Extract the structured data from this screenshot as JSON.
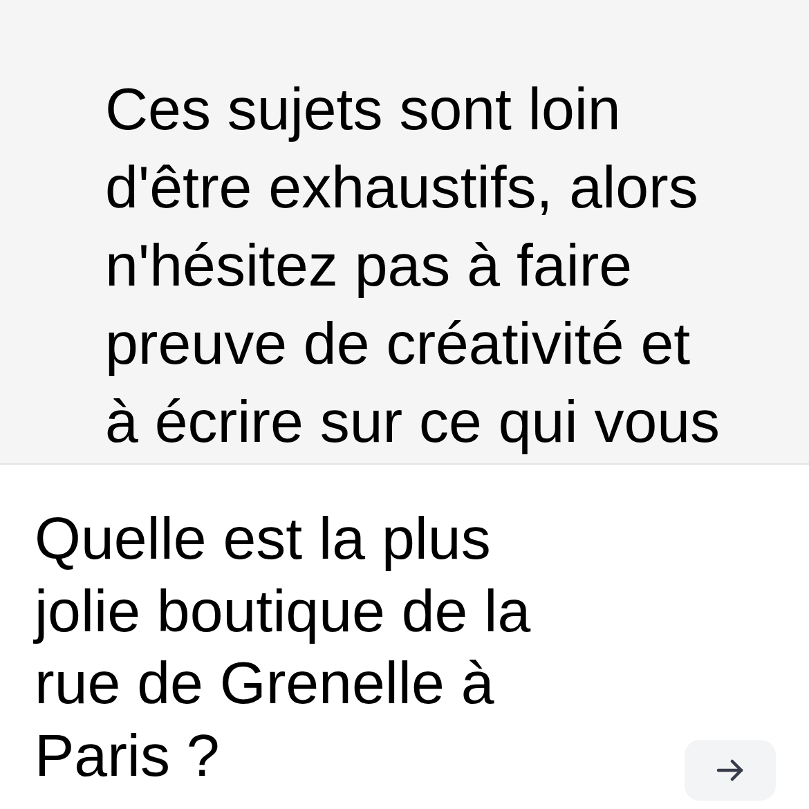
{
  "message": {
    "text": "Ces sujets sont loin d'être exhaustifs, alors n'hésitez pas à faire preuve de créativité et à écrire sur ce qui vous"
  },
  "composer": {
    "input": {
      "value": "Quelle est la plus jolie boutique de la rue de Grenelle à Paris ?"
    }
  }
}
